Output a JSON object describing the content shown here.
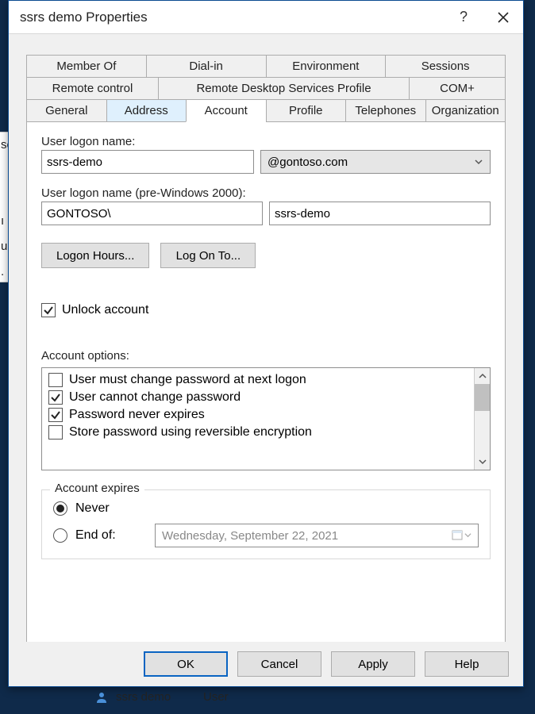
{
  "titlebar": {
    "title": "ssrs demo Properties"
  },
  "tabs": {
    "row1": [
      "Member Of",
      "Dial-in",
      "Environment",
      "Sessions"
    ],
    "row2": [
      "Remote control",
      "Remote Desktop Services Profile",
      "COM+"
    ],
    "row3": [
      "General",
      "Address",
      "Account",
      "Profile",
      "Telephones",
      "Organization"
    ],
    "active": "Account",
    "highlighted": "Address"
  },
  "account": {
    "logon_name_label": "User logon name:",
    "logon_name_value": "ssrs-demo",
    "upn_suffix": "@gontoso.com",
    "logon_name_pre2000_label": "User logon name (pre-Windows 2000):",
    "domain_prefix": "GONTOSO\\",
    "pre2000_value": "ssrs-demo",
    "logon_hours_btn": "Logon Hours...",
    "logon_to_btn": "Log On To...",
    "unlock_label": "Unlock account",
    "unlock_checked": true,
    "options_label": "Account options:",
    "options": [
      {
        "label": "User must change password at next logon",
        "checked": false
      },
      {
        "label": "User cannot change password",
        "checked": true
      },
      {
        "label": "Password never expires",
        "checked": true
      },
      {
        "label": "Store password using reversible encryption",
        "checked": false
      }
    ],
    "expires": {
      "legend": "Account expires",
      "never_label": "Never",
      "endof_label": "End of:",
      "selected": "never",
      "endof_date": "Wednesday, September 22, 2021"
    }
  },
  "footer": {
    "ok": "OK",
    "cancel": "Cancel",
    "apply": "Apply",
    "help": "Help"
  },
  "behind": {
    "name": "ssrs demo",
    "type": "User"
  }
}
